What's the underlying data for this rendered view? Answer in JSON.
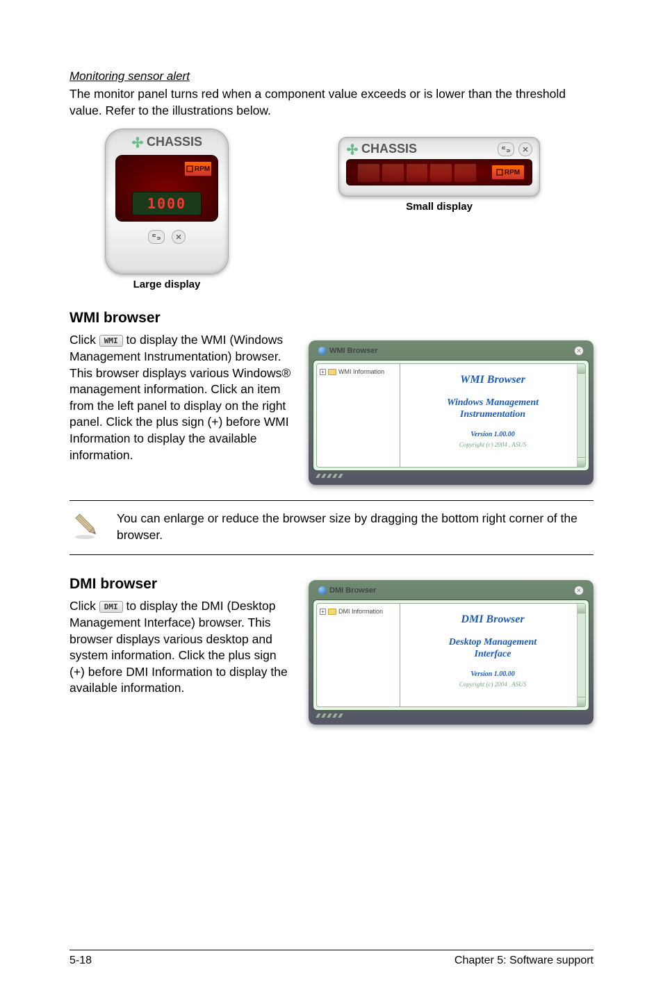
{
  "alert": {
    "heading": "Monitoring sensor alert",
    "body": "The monitor panel turns red when a component value exceeds or is lower than the threshold value. Refer to the illustrations below."
  },
  "gauge": {
    "title": "CHASSIS",
    "unit": "RPM",
    "lcd": "1000",
    "large_caption": "Large display",
    "small_caption": "Small display"
  },
  "wmi": {
    "title": "WMI browser",
    "body_1": "Click ",
    "body_2": " to display the WMI (Windows Management Instrumentation) browser. This browser displays various Windows® management information. Click an item from the left panel to display on the right panel. Click the plus sign (+) before WMI Information to display the available information.",
    "btn": "WMI",
    "win_title": "WMI Browser",
    "tree_root": "WMI Information",
    "content_h1": "WMI Browser",
    "content_h2a": "Windows Management",
    "content_h2b": "Instrumentation",
    "version": "Version 1.00.00",
    "copyright": "Copyright (c) 2004 , ASUS"
  },
  "note": {
    "text": "You can enlarge or reduce the browser size by dragging the bottom right corner of the browser."
  },
  "dmi": {
    "title": "DMI browser",
    "body_1": "Click ",
    "body_2": " to display the DMI (Desktop Management Interface) browser. This browser displays various desktop and system information. Click the plus sign (+) before DMI Information to display the available information.",
    "btn": "DMI",
    "win_title": "DMI Browser",
    "tree_root": "DMI Information",
    "content_h1": "DMI Browser",
    "content_h2a": "Desktop Management",
    "content_h2b": "Interface",
    "version": "Version 1.00.00",
    "copyright": "Copyright (c) 2004 , ASUS"
  },
  "footer": {
    "left": "5-18",
    "right": "Chapter 5: Software support"
  }
}
